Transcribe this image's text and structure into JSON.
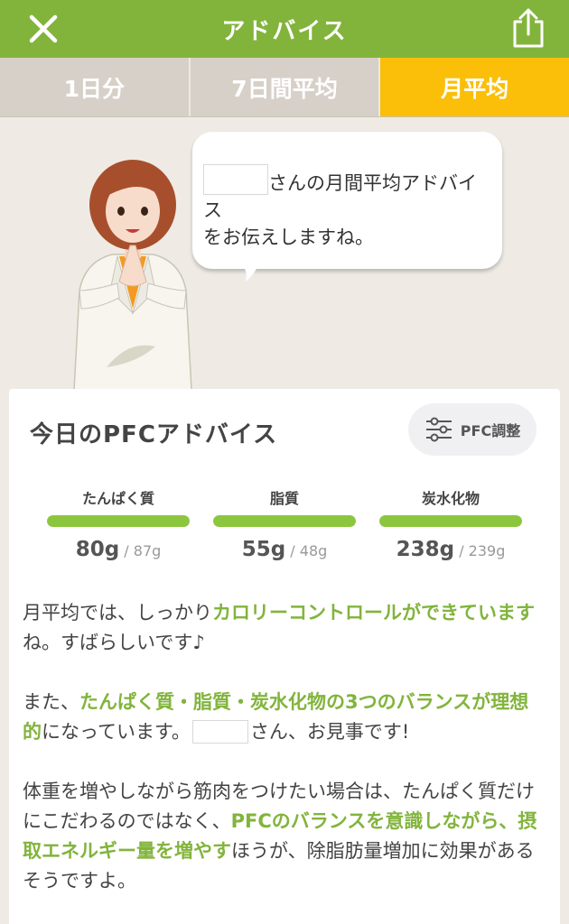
{
  "header": {
    "title": "アドバイス",
    "close_icon": "close-icon",
    "share_icon": "share-icon",
    "brand_color": "#82b43c"
  },
  "tabs": [
    {
      "label": "1日分",
      "active": false
    },
    {
      "label": "7日間平均",
      "active": false
    },
    {
      "label": "月平均",
      "active": true
    }
  ],
  "bubble": {
    "line1": "さんの月間平均アドバイス",
    "line2": "をお伝えしますね。"
  },
  "card": {
    "title": "今日のPFCアドバイス",
    "pfc_button_label": "PFC調整",
    "nutrients": [
      {
        "label": "たんぱく質",
        "actual": "80g",
        "target": "/ 87g",
        "progress": 1.0
      },
      {
        "label": "脂質",
        "actual": "55g",
        "target": "/ 48g",
        "progress": 1.0
      },
      {
        "label": "炭水化物",
        "actual": "238g",
        "target": "/ 239g",
        "progress": 1.0
      }
    ],
    "advice": {
      "p1": {
        "a": "月平均では、しっかり",
        "b": "カロリーコントロールができています",
        "c": "ね。すばらしいです♪"
      },
      "p2": {
        "a": "また、",
        "b": "たんぱく質・脂質・炭水化物の3つのバランスが理想的",
        "c": "になっています。",
        "d": "さん、お見事です!"
      },
      "p3": {
        "a": "体重を増やしながら筋肉をつけたい場合は、たんぱく質だけにこだわるのではなく、",
        "b": "PFCのバランスを意識しながら、摂取エネルギー量を増やす",
        "c": "ほうが、除脂肪量増加に効果があるそうですよ。"
      }
    }
  }
}
